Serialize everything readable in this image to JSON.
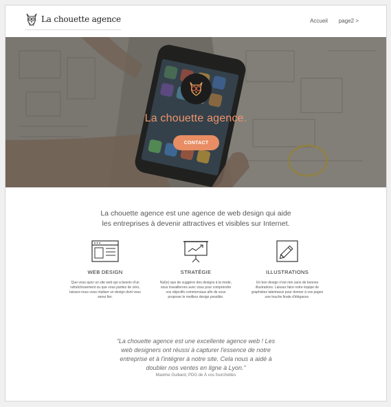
{
  "brand": {
    "name": "La chouette agence"
  },
  "nav": {
    "items": [
      {
        "label": "Accueil"
      },
      {
        "label": "page2 >"
      }
    ]
  },
  "hero": {
    "title": "La chouette agence.",
    "button_label": "CONTACT",
    "accent_color": "#e88d64"
  },
  "intro": {
    "line1": "La chouette agence est une agence de web design qui aide",
    "line2": "les entreprises à devenir attractives et visibles sur Internet."
  },
  "services": [
    {
      "icon": "web-design-icon",
      "title": "WEB DESIGN",
      "lines": [
        "Que vous ayez un site web qui a besoin d'un",
        "rafraîchissement ou que vous partiez de zéro,",
        "laissez-nous vous réaliser un design dont vous",
        "serez fier."
      ]
    },
    {
      "icon": "strategy-chart-icon",
      "title": "STRATÉGIE",
      "lines": [
        "Nul(e) que de suggérer des designs à la mode,",
        "nous travaillerons avec vous pour comprendre",
        "vos objectifs commerciaux afin de vous",
        "proposer le meilleur design possible."
      ]
    },
    {
      "icon": "pencil-illustration-icon",
      "title": "ILLUSTRATIONS",
      "lines": [
        "Un bon design n'est rien sans de bonnes",
        "illustrations. Laissez faire notre équipe de",
        "graphistes talentueux pour donner à vos pages",
        "une touche finale d'élégance."
      ]
    }
  ],
  "testimonial": {
    "lines": [
      "“La chouette agence est une excellente agence web ! Les",
      "web designers ont réussi à capturer l'essence de notre",
      "entreprise et à l'intégrer à notre site. Cela nous a aidé à",
      "doubler nos ventes en ligne à Lyon.”"
    ],
    "author": "Maxime Guibard, PDG de À vos fourchettes"
  }
}
